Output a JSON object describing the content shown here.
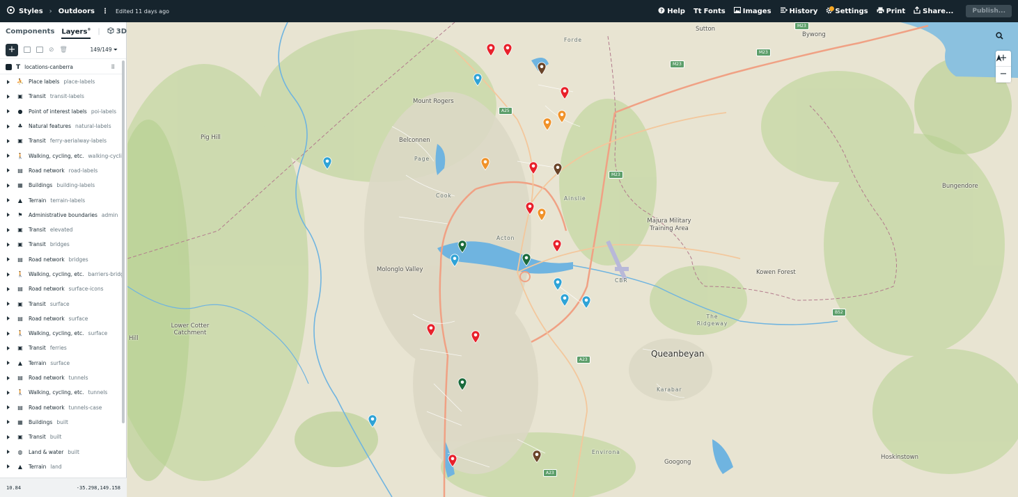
{
  "topbar": {
    "app_label": "Styles",
    "breadcrumb_sep": "›",
    "style_name": "Outdoors",
    "edited": "Edited 11 days ago",
    "help": "Help",
    "fonts": "Fonts",
    "images": "Images",
    "history": "History",
    "settings": "Settings",
    "print": "Print",
    "share": "Share...",
    "publish": "Publish..."
  },
  "sidebar": {
    "tab_components": "Components",
    "tab_layers": "Layers",
    "tab_3d": "3D",
    "layer_count": "149/149",
    "selected_layer": "locations-canberra",
    "layers": [
      {
        "icon": "person-pin-icon",
        "name": "Place labels",
        "id": "place-labels"
      },
      {
        "icon": "bus-icon",
        "name": "Transit",
        "id": "transit-labels"
      },
      {
        "icon": "pin-icon",
        "name": "Point of interest labels",
        "id": "poi-labels"
      },
      {
        "icon": "tree-icon",
        "name": "Natural features",
        "id": "natural-labels"
      },
      {
        "icon": "bus-icon",
        "name": "Transit",
        "id": "ferry-aerialway-labels"
      },
      {
        "icon": "walker-icon",
        "name": "Walking, cycling, etc.",
        "id": "walking-cycling-l"
      },
      {
        "icon": "car-icon",
        "name": "Road network",
        "id": "road-labels"
      },
      {
        "icon": "building-icon",
        "name": "Buildings",
        "id": "building-labels"
      },
      {
        "icon": "mountain-icon",
        "name": "Terrain",
        "id": "terrain-labels"
      },
      {
        "icon": "flag-icon",
        "name": "Administrative boundaries",
        "id": "admin"
      },
      {
        "icon": "bus-icon",
        "name": "Transit",
        "id": "elevated"
      },
      {
        "icon": "bus-icon",
        "name": "Transit",
        "id": "bridges"
      },
      {
        "icon": "car-icon",
        "name": "Road network",
        "id": "bridges"
      },
      {
        "icon": "walker-icon",
        "name": "Walking, cycling, etc.",
        "id": "barriers-bridges"
      },
      {
        "icon": "car-icon",
        "name": "Road network",
        "id": "surface-icons"
      },
      {
        "icon": "bus-icon",
        "name": "Transit",
        "id": "surface"
      },
      {
        "icon": "car-icon",
        "name": "Road network",
        "id": "surface"
      },
      {
        "icon": "walker-icon",
        "name": "Walking, cycling, etc.",
        "id": "surface"
      },
      {
        "icon": "bus-icon",
        "name": "Transit",
        "id": "ferries"
      },
      {
        "icon": "mountain-icon",
        "name": "Terrain",
        "id": "surface"
      },
      {
        "icon": "car-icon",
        "name": "Road network",
        "id": "tunnels"
      },
      {
        "icon": "walker-icon",
        "name": "Walking, cycling, etc.",
        "id": "tunnels"
      },
      {
        "icon": "car-icon",
        "name": "Road network",
        "id": "tunnels-case"
      },
      {
        "icon": "building-icon",
        "name": "Buildings",
        "id": "built"
      },
      {
        "icon": "bus-icon",
        "name": "Transit",
        "id": "built"
      },
      {
        "icon": "globe-icon",
        "name": "Land & water",
        "id": "built"
      },
      {
        "icon": "mountain-icon",
        "name": "Terrain",
        "id": "land"
      }
    ],
    "zoom": "10.84",
    "coords": "-35.298,149.158"
  },
  "map": {
    "labels": [
      "Sutton",
      "Bywong",
      "Forde",
      "Mount Rogers",
      "Pig Hill",
      "Belconnen",
      "Page",
      "Cook",
      "Ainslie",
      "Bungendore",
      "Majura Military Training Area",
      "Acton",
      "Molonglo Valley",
      "CBR",
      "Kowen Forest",
      "Lower Cotter Catchment",
      "Hill",
      "The Ridgeway",
      "Queanbeyan",
      "Karabar",
      "Environa",
      "Googong",
      "Hoskinstown"
    ],
    "road_shields": [
      "M23",
      "M23",
      "M23",
      "A25",
      "M23",
      "B52",
      "A23",
      "A23"
    ],
    "markers": {
      "red": "#e8212b",
      "orange": "#f0922a",
      "blue": "#2fa3d6",
      "brown": "#6a4428",
      "green": "#1b6b3d"
    }
  }
}
